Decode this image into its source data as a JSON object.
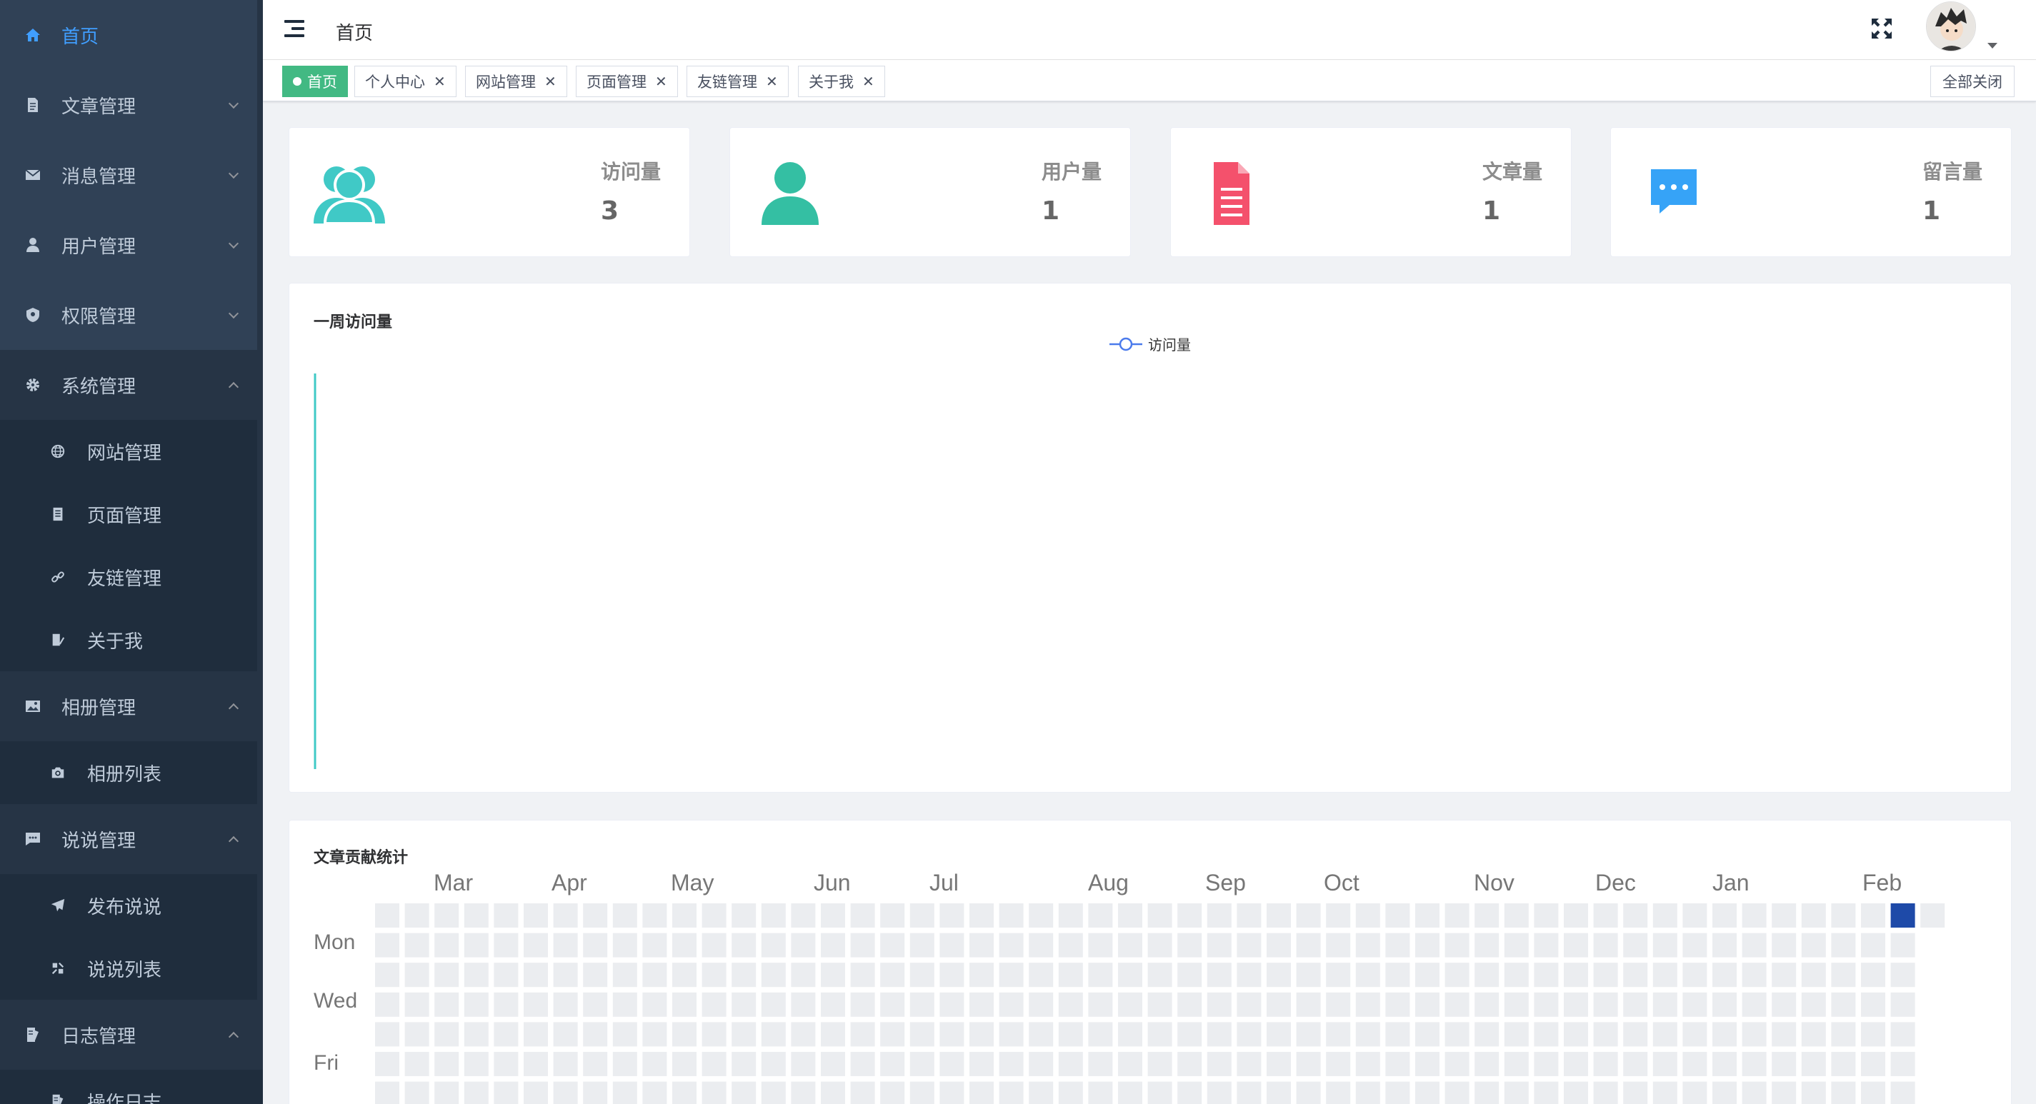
{
  "sidebar": {
    "items": [
      {
        "label": "首页",
        "icon": "home-icon",
        "level": 1,
        "home": true
      },
      {
        "label": "文章管理",
        "icon": "document-icon",
        "level": 1,
        "arrow": "down"
      },
      {
        "label": "消息管理",
        "icon": "mail-icon",
        "level": 1,
        "arrow": "down"
      },
      {
        "label": "用户管理",
        "icon": "user-icon",
        "level": 1,
        "arrow": "down"
      },
      {
        "label": "权限管理",
        "icon": "shield-icon",
        "level": 1,
        "arrow": "down"
      },
      {
        "label": "系统管理",
        "icon": "gear-icon",
        "level": 1,
        "arrow": "up",
        "open": true
      },
      {
        "label": "网站管理",
        "icon": "globe-icon",
        "level": 2
      },
      {
        "label": "页面管理",
        "icon": "page-icon",
        "level": 2
      },
      {
        "label": "友链管理",
        "icon": "link-icon",
        "level": 2
      },
      {
        "label": "关于我",
        "icon": "edit-icon",
        "level": 2
      },
      {
        "label": "相册管理",
        "icon": "picture-icon",
        "level": 1,
        "arrow": "up",
        "open": true
      },
      {
        "label": "相册列表",
        "icon": "camera-icon",
        "level": 2
      },
      {
        "label": "说说管理",
        "icon": "chat-icon",
        "level": 1,
        "arrow": "up",
        "open": true
      },
      {
        "label": "发布说说",
        "icon": "send-icon",
        "level": 2
      },
      {
        "label": "说说列表",
        "icon": "list-icon",
        "level": 2
      },
      {
        "label": "日志管理",
        "icon": "log-icon",
        "level": 1,
        "arrow": "up",
        "open": true
      },
      {
        "label": "操作日志",
        "icon": "log-icon",
        "level": 2
      }
    ]
  },
  "header": {
    "breadcrumb": "首页"
  },
  "tags": {
    "items": [
      {
        "label": "首页",
        "active": true
      },
      {
        "label": "个人中心"
      },
      {
        "label": "网站管理"
      },
      {
        "label": "页面管理"
      },
      {
        "label": "友链管理"
      },
      {
        "label": "关于我"
      }
    ],
    "close_all": "全部关闭"
  },
  "stats": [
    {
      "label": "访问量",
      "value": "3",
      "icon": "users-icon",
      "color": "#40c9c6"
    },
    {
      "label": "用户量",
      "value": "1",
      "icon": "user-icon",
      "color": "#34bfa3"
    },
    {
      "label": "文章量",
      "value": "1",
      "icon": "article-icon",
      "color": "#f4516c"
    },
    {
      "label": "留言量",
      "value": "1",
      "icon": "message-icon",
      "color": "#36a3f7"
    }
  ],
  "visits_chart": {
    "title": "一周访问量",
    "legend": "访问量",
    "line_color": "#4b7bec",
    "axis_color": "#40c9c6"
  },
  "contrib": {
    "title": "文章贡献统计",
    "months": [
      "Mar",
      "Apr",
      "May",
      "Jun",
      "Jul",
      "Aug",
      "Sep",
      "Oct",
      "Nov",
      "Dec",
      "Jan",
      "Feb"
    ],
    "days": [
      "Mon",
      "Wed",
      "Fri"
    ],
    "empty_color": "#ebedf0",
    "active_color": "#1e4aa8",
    "active_cell": {
      "week": 51,
      "day": 0
    }
  }
}
